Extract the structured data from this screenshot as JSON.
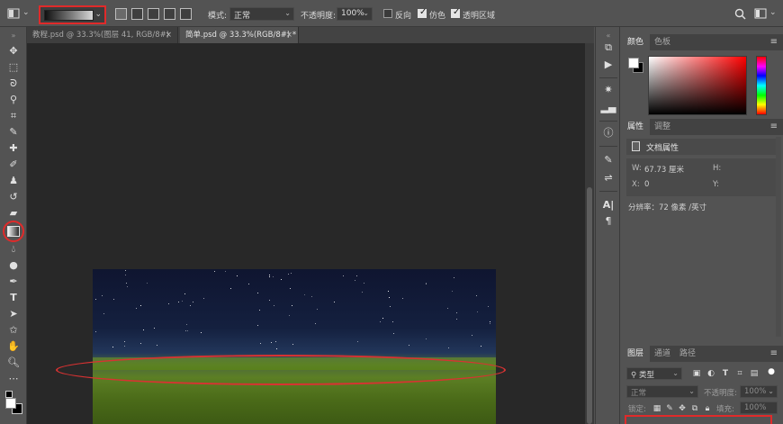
{
  "options_bar": {
    "mode_label": "模式:",
    "mode_value": "正常",
    "opacity_label": "不透明度:",
    "opacity_value": "100%",
    "reverse_label": "反向",
    "reverse_checked": false,
    "dither_label": "仿色",
    "dither_checked": true,
    "transparency_label": "透明区域",
    "transparency_checked": true
  },
  "tabs": [
    {
      "label": "教程.psd @ 33.3%(图层 41, RGB/8#)",
      "active": false
    },
    {
      "label": "简单.psd @ 33.3%(RGB/8#) *",
      "active": true
    }
  ],
  "color_panel": {
    "tabs": [
      "颜色",
      "色板"
    ],
    "active_tab": "颜色",
    "foreground": "#ffffff",
    "background": "#000000",
    "hue_color": "#ff0000"
  },
  "properties_panel": {
    "tabs": [
      "属性",
      "调整"
    ],
    "active_tab": "属性",
    "section": "文档属性",
    "w_label": "W:",
    "w_value": "67.73 厘米",
    "h_label": "H:",
    "x_label": "X:",
    "x_value": "0",
    "y_label": "Y:",
    "resolution": "分辨率：72 像素 /英寸"
  },
  "layers_panel": {
    "tabs": [
      "图层",
      "通道",
      "路径"
    ],
    "active_tab": "图层",
    "filter_value": "类型",
    "blend_mode": "正常",
    "opacity_label": "不透明度:",
    "opacity_value": "100%",
    "lock_label": "锁定:",
    "fill_label": "填充:",
    "fill_value": "100%"
  },
  "annotations": {
    "highlight_color": "#e02a2a"
  }
}
